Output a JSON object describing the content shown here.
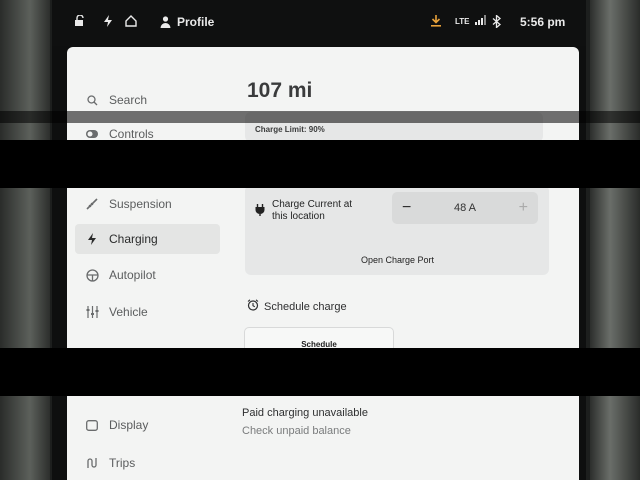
{
  "status_bar": {
    "profile_label": "Profile",
    "network_label": "LTE",
    "time": "5:56 pm",
    "icons": [
      "lock-open-icon",
      "bolt-icon",
      "home-icon",
      "person-icon",
      "download-icon",
      "signal-icon",
      "bluetooth-icon"
    ]
  },
  "sidebar": {
    "items": [
      {
        "label": "Search",
        "icon": "search-icon"
      },
      {
        "label": "Controls",
        "icon": "toggle-icon"
      },
      {
        "label": "Suspension",
        "icon": "suspension-icon"
      },
      {
        "label": "Charging",
        "icon": "bolt-icon",
        "active": true
      },
      {
        "label": "Autopilot",
        "icon": "steering-wheel-icon"
      },
      {
        "label": "Vehicle",
        "icon": "sliders-icon"
      },
      {
        "label": "Display",
        "icon": "display-icon"
      },
      {
        "label": "Trips",
        "icon": "trips-icon"
      }
    ]
  },
  "charging": {
    "range": "107 mi",
    "charge_limit_label": "Charge Limit: 90%",
    "charge_current_label": "Charge Current at this location",
    "charge_current_value": "48 A",
    "decrement_symbol": "−",
    "increment_symbol": "+",
    "open_port_label": "Open Charge Port",
    "schedule_charge_label": "Schedule charge",
    "schedule_button_label": "Schedule",
    "paid_charging_title": "Paid charging unavailable",
    "check_balance_label": "Check unpaid balance"
  },
  "colors": {
    "panel_bg": "#f3f4f3",
    "accent_download": "#e8a23a",
    "active_item_bg": "#e4e5e4"
  }
}
